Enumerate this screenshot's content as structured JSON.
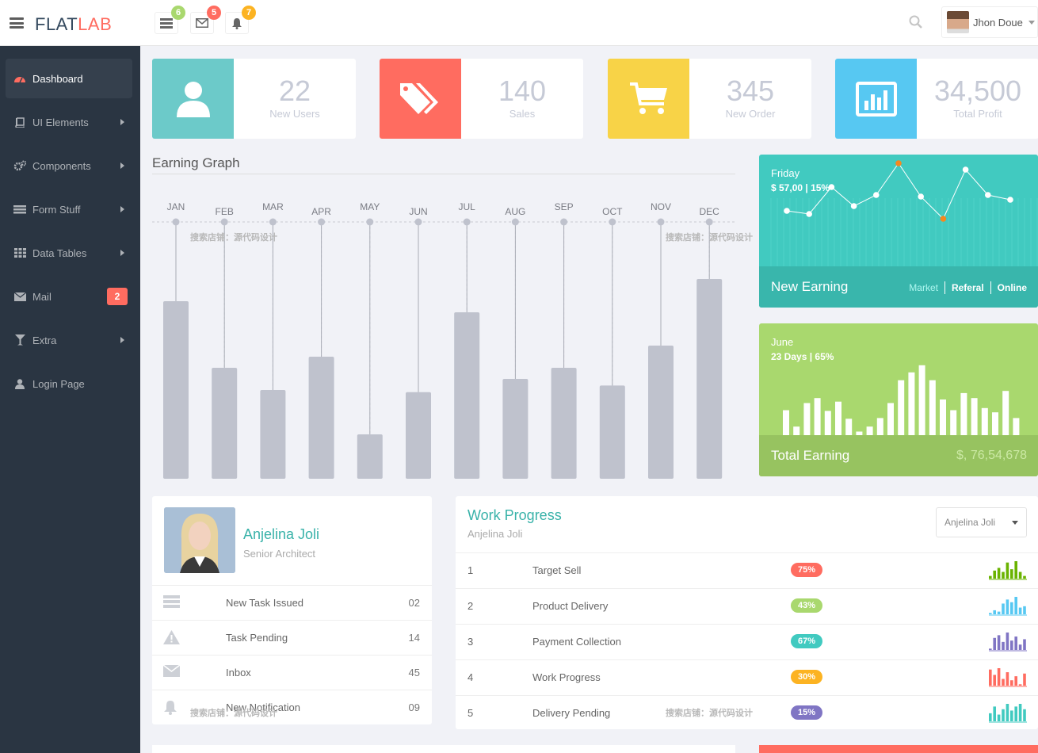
{
  "header": {
    "logo_a": "FLAT",
    "logo_b": "LAB",
    "notifications": [
      {
        "icon": "tasks-icon",
        "count": "6",
        "color": "#a9d86e"
      },
      {
        "icon": "envelope-icon",
        "count": "5",
        "color": "#ff6c60"
      },
      {
        "icon": "bell-icon",
        "count": "7",
        "color": "#fcb322"
      }
    ],
    "user_name": "Jhon Doue"
  },
  "sidebar": {
    "items": [
      {
        "label": "Dashboard",
        "icon": "dashboard-icon"
      },
      {
        "label": "UI Elements",
        "icon": "book-icon"
      },
      {
        "label": "Components",
        "icon": "cogs-icon"
      },
      {
        "label": "Form Stuff",
        "icon": "tasks-icon"
      },
      {
        "label": "Data Tables",
        "icon": "grid-icon"
      },
      {
        "label": "Mail",
        "icon": "envelope-icon",
        "badge": "2"
      },
      {
        "label": "Extra",
        "icon": "glass-icon"
      },
      {
        "label": "Login Page",
        "icon": "user-icon"
      }
    ]
  },
  "stats": [
    {
      "value": "22",
      "label": "New Users",
      "color": "#6ccac9",
      "icon": "user-icon"
    },
    {
      "value": "140",
      "label": "Sales",
      "color": "#ff6c60",
      "icon": "tags-icon"
    },
    {
      "value": "345",
      "label": "New Order",
      "color": "#f8d347",
      "icon": "cart-icon"
    },
    {
      "value": "34,500",
      "label": "Total Profit",
      "color": "#57c8f2",
      "icon": "bar-chart-icon"
    }
  ],
  "earning_graph": {
    "title": "Earning Graph"
  },
  "chart_data": [
    {
      "type": "bar",
      "categories": [
        "JAN",
        "FEB",
        "MAR",
        "APR",
        "MAY",
        "JUN",
        "JUL",
        "AUG",
        "SEP",
        "OCT",
        "NOV",
        "DEC"
      ],
      "values": [
        80,
        50,
        40,
        55,
        20,
        39,
        75,
        45,
        50,
        42,
        60,
        90
      ],
      "ylim": [
        0,
        100
      ]
    },
    {
      "type": "line",
      "values": [
        35,
        33,
        50,
        38,
        45,
        65,
        44,
        30,
        61,
        45,
        42
      ],
      "highlighted_points": [
        5,
        7
      ],
      "highlight_color": "#f5881f"
    },
    {
      "type": "bar",
      "values": [
        35,
        12,
        45,
        52,
        34,
        47,
        23,
        5,
        12,
        24,
        45,
        77,
        88,
        98,
        77,
        50,
        35,
        59,
        52,
        38,
        32,
        62,
        24
      ]
    }
  ],
  "widget_new_earning": {
    "day": "Friday",
    "detail": "$ 57,00 | 15%",
    "title": "New Earning",
    "links": [
      "Market",
      "Referal",
      "Online"
    ]
  },
  "widget_total_earning": {
    "month": "June",
    "detail": "23 Days | 65%",
    "title": "Total Earning",
    "amount": "$, 76,54,678"
  },
  "profile": {
    "name": "Anjelina Joli",
    "role": "Senior Architect",
    "rows": [
      {
        "label": "New Task Issued",
        "count": "02",
        "icon": "tasks-icon"
      },
      {
        "label": "Task Pending",
        "count": "14",
        "icon": "warning-icon"
      },
      {
        "label": "Inbox",
        "count": "45",
        "icon": "envelope-icon"
      },
      {
        "label": "New Notification",
        "count": "09",
        "icon": "bell-icon"
      }
    ]
  },
  "work_progress": {
    "title": "Work Progress",
    "subtitle": "Anjelina Joli",
    "select_value": "Anjelina Joli",
    "rows": [
      {
        "num": "1",
        "task": "Target Sell",
        "pct": "75%",
        "color": "#ff6c60",
        "spark_color": "#6ab300",
        "spark": [
          2,
          6,
          8,
          5,
          12,
          7,
          13,
          5,
          2
        ]
      },
      {
        "num": "2",
        "task": "Product Delivery",
        "pct": "43%",
        "color": "#a9d86e",
        "spark_color": "#57c8f2",
        "spark": [
          1,
          3,
          2,
          8,
          11,
          9,
          13,
          5,
          6
        ]
      },
      {
        "num": "3",
        "task": "Payment Collection",
        "pct": "67%",
        "color": "#41cac0",
        "spark_color": "#8075c4",
        "spark": [
          1,
          9,
          11,
          6,
          13,
          7,
          10,
          4,
          8
        ]
      },
      {
        "num": "4",
        "task": "Work Progress",
        "pct": "30%",
        "color": "#fcb322",
        "spark_color": "#ff6c60",
        "spark": [
          12,
          8,
          13,
          5,
          10,
          4,
          7,
          1,
          9
        ]
      },
      {
        "num": "5",
        "task": "Delivery Pending",
        "pct": "15%",
        "color": "#8075c4",
        "spark_color": "#41cac0",
        "spark": [
          6,
          11,
          5,
          9,
          13,
          8,
          11,
          13,
          9
        ]
      }
    ]
  },
  "watermarks": [
    "搜索店铺：源代码设计",
    "搜索店铺：源代码设计",
    "搜索店铺：源代码设计",
    "搜索店铺：源代码设计"
  ]
}
